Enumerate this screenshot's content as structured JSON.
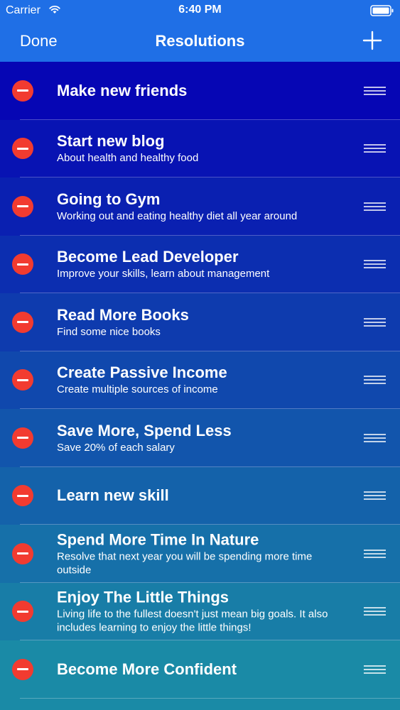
{
  "status_bar": {
    "carrier": "Carrier",
    "time": "6:40 PM"
  },
  "nav": {
    "done_label": "Done",
    "title": "Resolutions",
    "add_icon": "plus-icon"
  },
  "colors": {
    "nav_background": "#1f6fe6",
    "delete_red": "#f23b30",
    "gradient_start": "#0606b4",
    "gradient_end": "#1a8aa6"
  },
  "icons": {
    "row_delete": "minus-circle-icon",
    "row_reorder": "reorder-handle-icon"
  },
  "resolutions": [
    {
      "title": "Make new friends",
      "subtitle": ""
    },
    {
      "title": "Start new blog",
      "subtitle": "About health and healthy food"
    },
    {
      "title": "Going to Gym",
      "subtitle": "Working out and eating healthy diet all year around"
    },
    {
      "title": "Become Lead Developer",
      "subtitle": "Improve your skills, learn about management"
    },
    {
      "title": "Read More Books",
      "subtitle": "Find some nice books"
    },
    {
      "title": "Create Passive Income",
      "subtitle": "Create multiple sources of income"
    },
    {
      "title": "Save More, Spend Less",
      "subtitle": "Save 20% of each salary"
    },
    {
      "title": "Learn new skill",
      "subtitle": ""
    },
    {
      "title": "Spend More Time In Nature",
      "subtitle": "Resolve that next year you will be spending more time outside"
    },
    {
      "title": "Enjoy The Little Things",
      "subtitle": "Living life to the fullest doesn't just mean big goals. It also includes learning to enjoy the little things!"
    },
    {
      "title": "Become More Confident",
      "subtitle": ""
    }
  ]
}
